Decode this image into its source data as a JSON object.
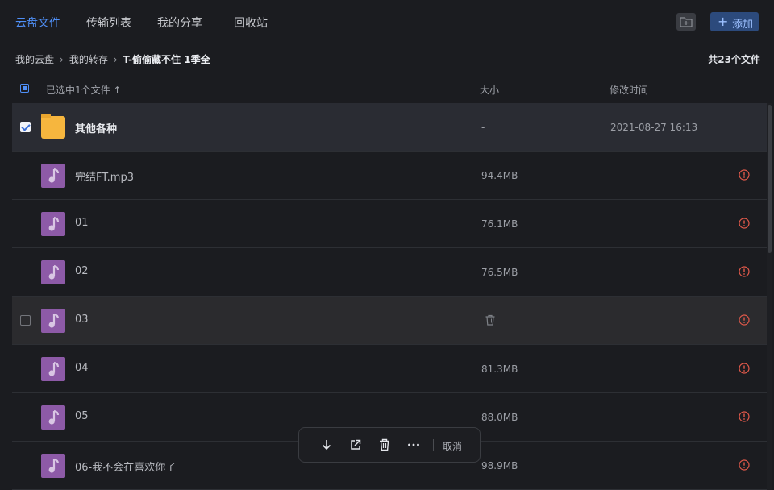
{
  "tabs": [
    {
      "label": "云盘文件",
      "active": true
    },
    {
      "label": "传输列表",
      "active": false
    },
    {
      "label": "我的分享",
      "active": false
    },
    {
      "label": "回收站",
      "active": false
    }
  ],
  "toolbar": {
    "add_label": "添加"
  },
  "breadcrumb": [
    "我的云盘",
    "我的转存",
    "T-偷偷藏不住 1季全"
  ],
  "file_count": "共23个文件",
  "header": {
    "selection": "已选中1个文件 ↑",
    "size": "大小",
    "modified": "修改时间"
  },
  "files": [
    {
      "name": "其他各种",
      "type": "folder",
      "size": "-",
      "modified": "2021-08-27 16:13",
      "checked": true
    },
    {
      "name": "完结FT.mp3",
      "type": "music",
      "size": "94.4MB",
      "modified": ""
    },
    {
      "name": "01",
      "type": "music",
      "size": "76.1MB",
      "modified": ""
    },
    {
      "name": "02",
      "type": "music",
      "size": "76.5MB",
      "modified": ""
    },
    {
      "name": "03",
      "type": "music",
      "size": "",
      "modified": "",
      "hover": true
    },
    {
      "name": "04",
      "type": "music",
      "size": "81.3MB",
      "modified": ""
    },
    {
      "name": "05",
      "type": "music",
      "size": "88.0MB",
      "modified": ""
    },
    {
      "name": "06-我不会在喜欢你了",
      "type": "music",
      "size": "98.9MB",
      "modified": ""
    }
  ],
  "actionbar": {
    "cancel_label": "取消"
  },
  "colors": {
    "accent": "#4f8ff7",
    "folder": "#f6b63e",
    "music": "#8d5aa7",
    "warning": "#e2594a"
  }
}
